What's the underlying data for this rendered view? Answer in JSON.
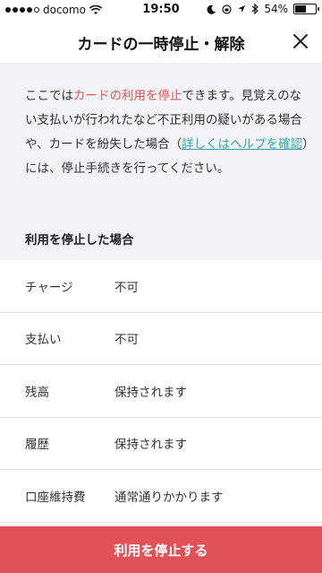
{
  "status_bar": {
    "carrier": "docomo",
    "time": "19:50",
    "battery": "54%",
    "battery_level": 0.54,
    "signal_bars_filled": 4,
    "signal_bars_total": 5
  },
  "nav": {
    "title": "カードの一時停止・解除"
  },
  "intro": {
    "text_before": "ここでは",
    "highlight": "カードの利用を停止",
    "text_after": "できます。見覚えのない支払いが行われたなど不正利用の疑いがある場合や、カードを紛失した場合（",
    "link": "詳しくはヘルプを確認",
    "text_end": "）には、停止手続きを行ってください。"
  },
  "section": {
    "heading": "利用を停止した場合"
  },
  "rows": [
    {
      "label": "チャージ",
      "value": "不可"
    },
    {
      "label": "支払い",
      "value": "不可"
    },
    {
      "label": "残高",
      "value": "保持されます"
    },
    {
      "label": "履歴",
      "value": "保持されます"
    },
    {
      "label": "口座維持費",
      "value": "通常通りかかります"
    }
  ],
  "action": {
    "label": "利用を停止する"
  },
  "colors": {
    "accent_red": "#e05257",
    "link_teal": "#33a6a6",
    "intro_bg": "#f3f3f5"
  }
}
